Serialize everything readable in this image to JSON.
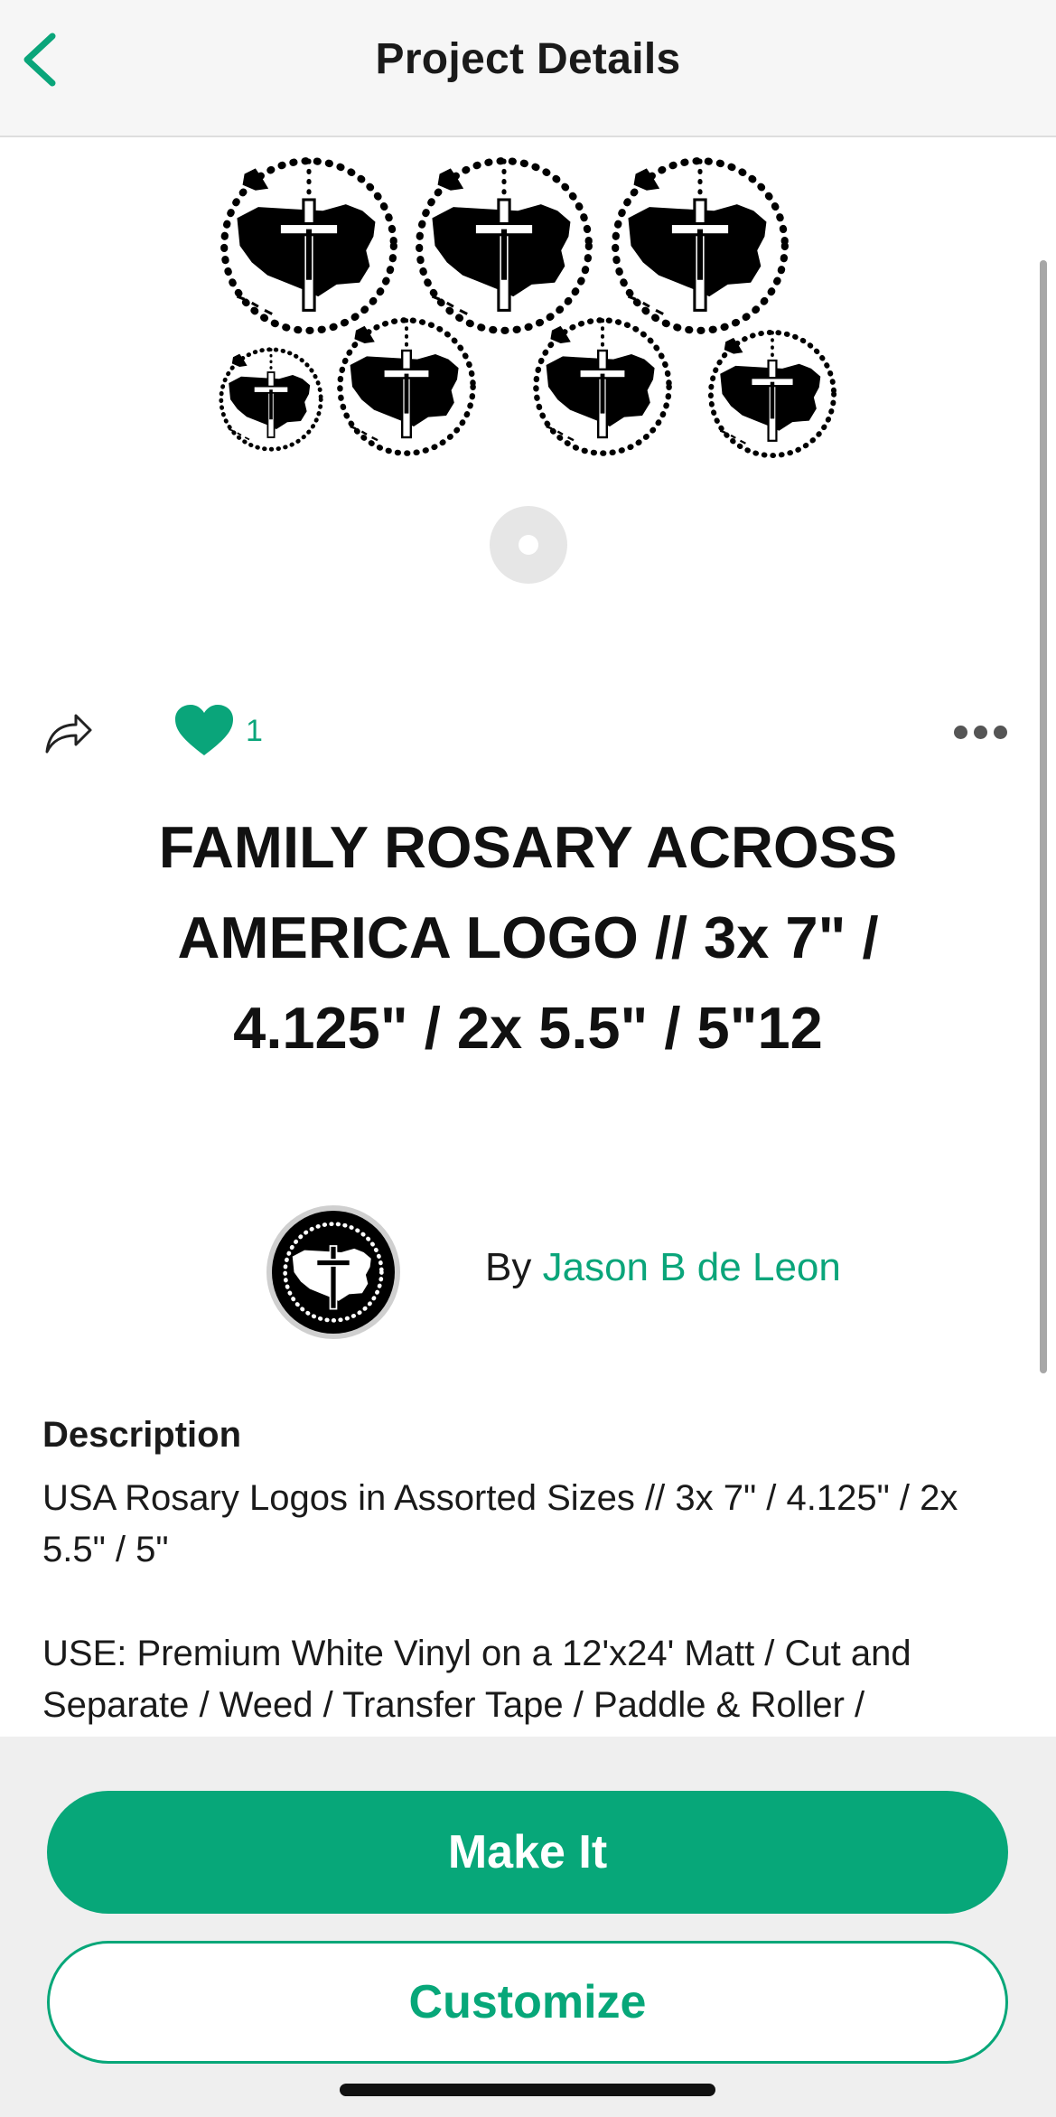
{
  "header": {
    "title": "Project Details",
    "back_icon": "chevron-left-icon",
    "accent_color": "#0aa57a"
  },
  "hero": {
    "image_description_icon": "usa-rosary-logo-set",
    "carousel_pages": 1,
    "current_page": 1
  },
  "actions": {
    "share_icon": "share-arrow-icon",
    "like_icon": "heart-icon",
    "like_count": "1",
    "more_icon": "more-dots-icon"
  },
  "project": {
    "title": "FAMILY ROSARY ACROSS AMERICA LOGO // 3x 7\" / 4.125\" / 2x 5.5\" / 5\"12"
  },
  "author": {
    "by_label": "By",
    "name": "Jason B de Leon"
  },
  "description": {
    "heading": "Description",
    "paragraph_1": "USA Rosary Logos in Assorted Sizes // 3x 7\" / 4.125\" / 2x 5.5\" / 5\"",
    "paragraph_2": "USE: Premium White Vinyl on a 12'x24' Matt / Cut and Separate / Weed / Transfer Tape / Paddle & Roller /"
  },
  "buttons": {
    "make_it": "Make It",
    "customize": "Customize"
  },
  "colors": {
    "brand_green": "#07a779",
    "header_bg": "#f6f6f6",
    "panel_bg": "#efefef"
  }
}
